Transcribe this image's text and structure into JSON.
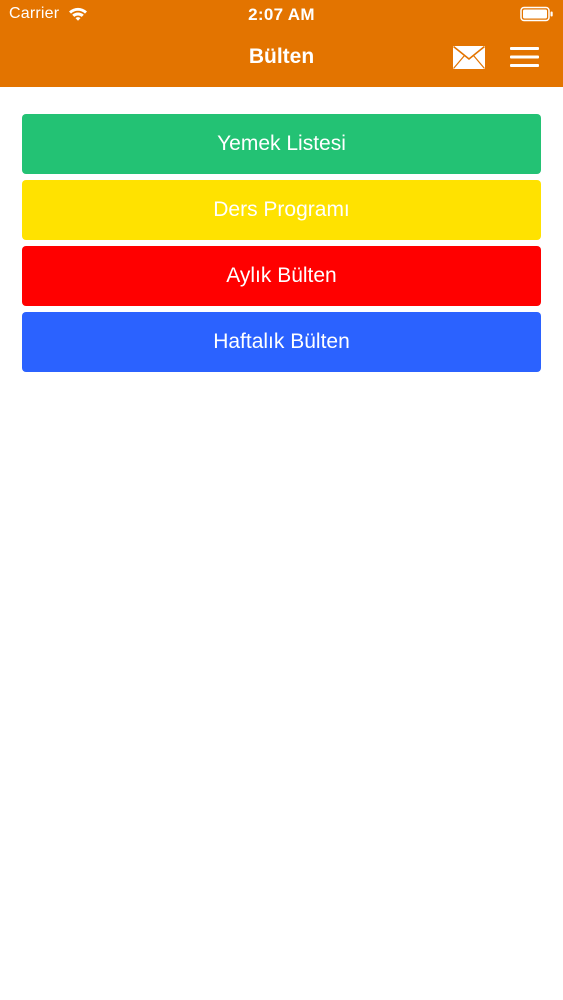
{
  "status_bar": {
    "carrier": "Carrier",
    "time": "2:07 AM"
  },
  "nav": {
    "title": "Bülten"
  },
  "menu": {
    "items": [
      {
        "label": "Yemek Listesi",
        "color": "#23c274"
      },
      {
        "label": "Ders Programı",
        "color": "#ffe200"
      },
      {
        "label": "Aylık Bülten",
        "color": "#ff0000"
      },
      {
        "label": "Haftalık Bülten",
        "color": "#2b62ff"
      }
    ]
  },
  "colors": {
    "header": "#e37400",
    "background": "#ffffff",
    "text": "#ffffff"
  },
  "icons": [
    "wifi-icon",
    "battery-icon",
    "mail-icon",
    "menu-icon"
  ]
}
